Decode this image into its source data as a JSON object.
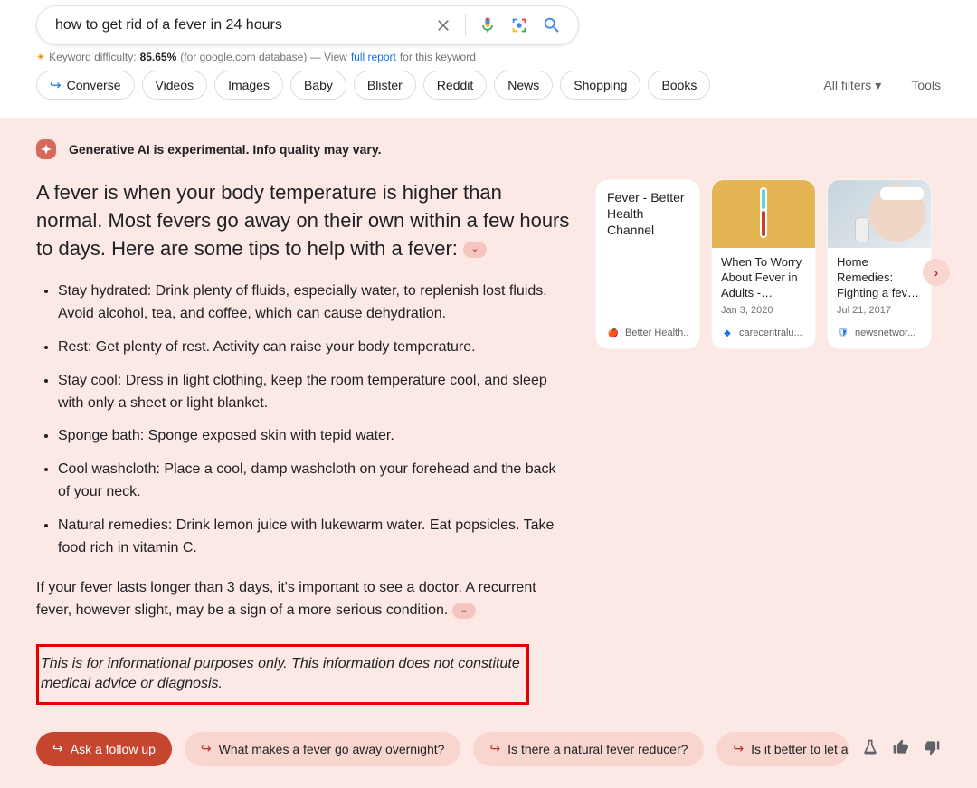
{
  "search": {
    "query": "how to get rid of a fever in 24 hours"
  },
  "keyword_difficulty": {
    "label": "Keyword difficulty:",
    "value": "85.65%",
    "suffix1": "(for google.com database) — View",
    "link": "full report",
    "suffix2": "for this keyword"
  },
  "filters": {
    "first_with_icon": "Converse",
    "items": [
      "Videos",
      "Images",
      "Baby",
      "Blister",
      "Reddit",
      "News",
      "Shopping",
      "Books"
    ],
    "all_filters": "All filters",
    "tools": "Tools"
  },
  "sge": {
    "badge_text": "Generative AI is experimental. Info quality may vary.",
    "intro": "A fever is when your body temperature is higher than normal. Most fevers go away on their own within a few hours to days. Here are some tips to help with a fever:",
    "bullets": [
      "Stay hydrated: Drink plenty of fluids, especially water, to replenish lost fluids. Avoid alcohol, tea, and coffee, which can cause dehydration.",
      "Rest: Get plenty of rest. Activity can raise your body temperature.",
      "Stay cool: Dress in light clothing, keep the room temperature cool, and sleep with only a sheet or light blanket.",
      "Sponge bath: Sponge exposed skin with tepid water.",
      "Cool washcloth: Place a cool, damp washcloth on your forehead and the back of your neck.",
      "Natural remedies: Drink lemon juice with lukewarm water. Eat popsicles. Take food rich in vitamin C."
    ],
    "outro": "If your fever lasts longer than 3 days, it's important to see a doctor. A recurrent fever, however slight, may be a sign of a more serious condition.",
    "disclaimer": "This is for informational purposes only. This information does not constitute medical advice or diagnosis."
  },
  "cards": [
    {
      "title": "Fever - Better Health Channel",
      "date": "",
      "source": "Better Health...",
      "color": "#c0392b",
      "image": false
    },
    {
      "title": "When To Worry About Fever in Adults -…",
      "date": "Jan 3, 2020",
      "source": "carecentralu...",
      "color": "#1a73e8",
      "image": true,
      "bg": "#e5b554"
    },
    {
      "title": "Home Remedies: Fighting a fev…",
      "date": "Jul 21, 2017",
      "source": "newsnetwor...",
      "color": "#1a73e8",
      "image": true,
      "bg": "#d8e0e7"
    }
  ],
  "followups": {
    "main": "Ask a follow up",
    "suggestions": [
      "What makes a fever go away overnight?",
      "Is there a natural fever reducer?",
      "Is it better to let a fever burn ou"
    ]
  }
}
